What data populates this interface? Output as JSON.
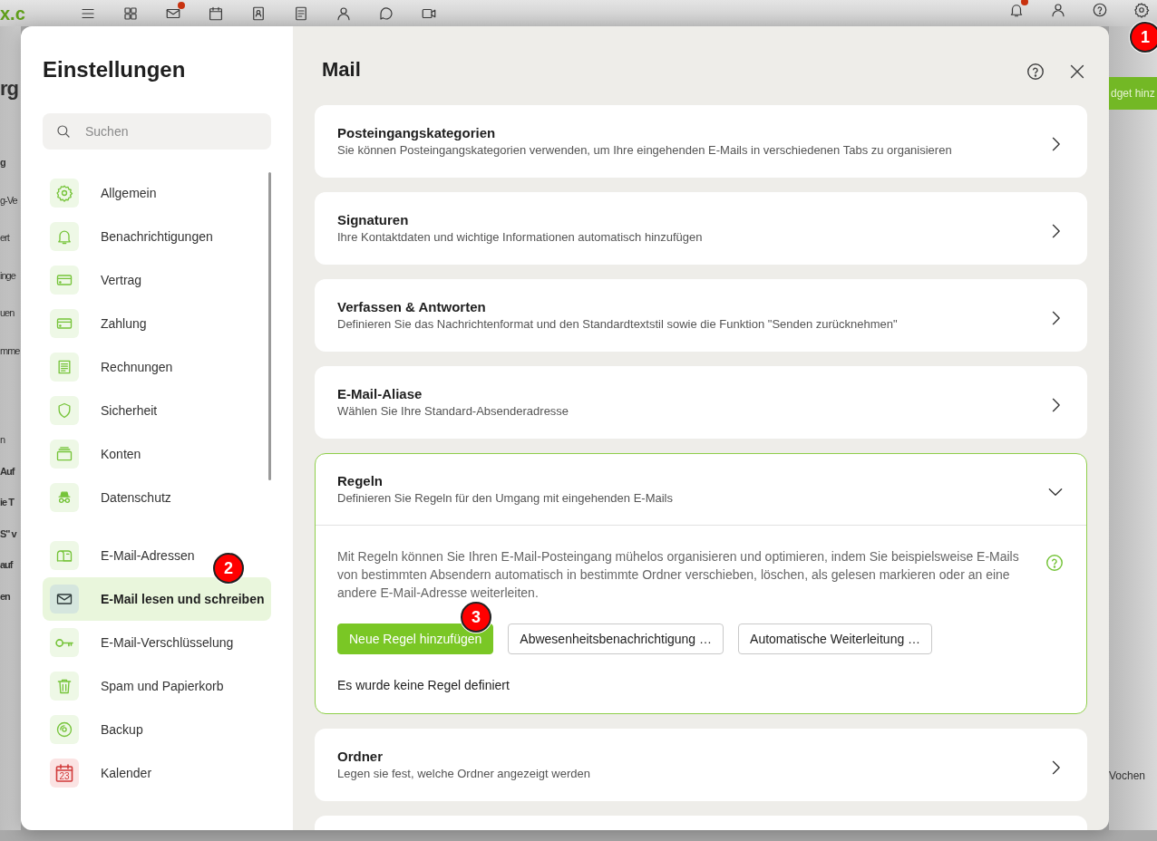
{
  "app_background": {
    "logo": "x.c",
    "top_icons": [
      {
        "dot": false
      },
      {
        "dot": false
      },
      {
        "dot": true
      },
      {
        "dot": false
      },
      {
        "dot": false
      },
      {
        "dot": false
      },
      {
        "dot": false
      },
      {
        "dot": false
      },
      {
        "dot": false
      }
    ],
    "top_right_icons": [
      {
        "dot": true
      },
      {
        "dot": false
      },
      {
        "dot": false
      },
      {
        "dot": false,
        "marker": "1"
      }
    ],
    "left_fragments": [
      {
        "items": [
          {
            "text": "rg",
            "kind": "heading"
          }
        ]
      },
      {
        "items": [
          {
            "text": "g",
            "kind": "bold"
          },
          {
            "text": "g-Ve",
            "kind": "text"
          },
          {
            "text": "ert",
            "kind": "text"
          },
          {
            "text": "inge",
            "kind": "text"
          },
          {
            "text": "uen",
            "kind": "text"
          },
          {
            "text": "mme",
            "kind": "text"
          }
        ]
      },
      {
        "items": [
          {
            "text": "n",
            "kind": "text"
          },
          {
            "text": "Auf",
            "kind": "bold"
          },
          {
            "text": "ie T",
            "kind": "bold"
          },
          {
            "text": "S\" v",
            "kind": "bold"
          },
          {
            "text": "auf",
            "kind": "bold"
          },
          {
            "text": "en",
            "kind": "bold"
          }
        ]
      }
    ],
    "widget_button": "dget hinz",
    "right_fragment": "Vochen"
  },
  "settings": {
    "title": "Einstellungen",
    "search": {
      "placeholder": "Suchen"
    },
    "groups": [
      {
        "items": [
          {
            "label": "Allgemein",
            "selected": false
          },
          {
            "label": "Benachrichtigungen",
            "selected": false
          },
          {
            "label": "Vertrag",
            "selected": false
          },
          {
            "label": "Zahlung",
            "selected": false
          },
          {
            "label": "Rechnungen",
            "selected": false
          },
          {
            "label": "Sicherheit",
            "selected": false
          },
          {
            "label": "Konten",
            "selected": false
          },
          {
            "label": "Datenschutz",
            "selected": false
          }
        ]
      },
      {
        "items": [
          {
            "label": "E-Mail-Adressen",
            "selected": false
          },
          {
            "label": "E-Mail lesen und schreiben",
            "selected": true,
            "marker": "2"
          },
          {
            "label": "E-Mail-Verschlüsselung",
            "selected": false
          },
          {
            "label": "Spam und Papierkorb",
            "selected": false
          },
          {
            "label": "Backup",
            "selected": false
          },
          {
            "label": "Kalender",
            "selected": false,
            "icon_text": "23"
          }
        ]
      }
    ]
  },
  "panel": {
    "title": "Mail",
    "sections": [
      {
        "title": "Posteingangskategorien",
        "subtitle": "Sie können Posteingangskategorien verwenden, um Ihre eingehenden E-Mails in verschiedenen Tabs zu organisieren",
        "expanded": false
      },
      {
        "title": "Signaturen",
        "subtitle": "Ihre Kontaktdaten und wichtige Informationen automatisch hinzufügen",
        "expanded": false
      },
      {
        "title": "Verfassen & Antworten",
        "subtitle": "Definieren Sie das Nachrichtenformat und den Standardtextstil sowie die Funktion \"Senden zurücknehmen\"",
        "expanded": false
      },
      {
        "title": "E-Mail-Aliase",
        "subtitle": "Wählen Sie Ihre Standard-Absenderadresse",
        "expanded": false
      },
      {
        "title": "Regeln",
        "subtitle": "Definieren Sie Regeln für den Umgang mit eingehenden E-Mails",
        "expanded": true,
        "body": {
          "description": "Mit Regeln können Sie Ihren E-Mail-Posteingang mühelos organisieren und optimieren, indem Sie beispielsweise E-Mails von bestimmten Absendern automatisch in bestimmte Ordner verschieben, löschen, als gelesen markieren oder an eine andere E-Mail-Adresse weiterleiten.",
          "buttons": [
            {
              "label": "Neue Regel hinzufügen",
              "kind": "primary",
              "marker": "3"
            },
            {
              "label": "Abwesenheitsbenachrichtigung …",
              "kind": "outline"
            },
            {
              "label": "Automatische Weiterleitung …",
              "kind": "outline"
            }
          ],
          "empty_note": "Es wurde keine Regel definiert"
        }
      },
      {
        "title": "Ordner",
        "subtitle": "Legen sie fest, welche Ordner angezeigt werden",
        "expanded": false
      }
    ]
  }
}
